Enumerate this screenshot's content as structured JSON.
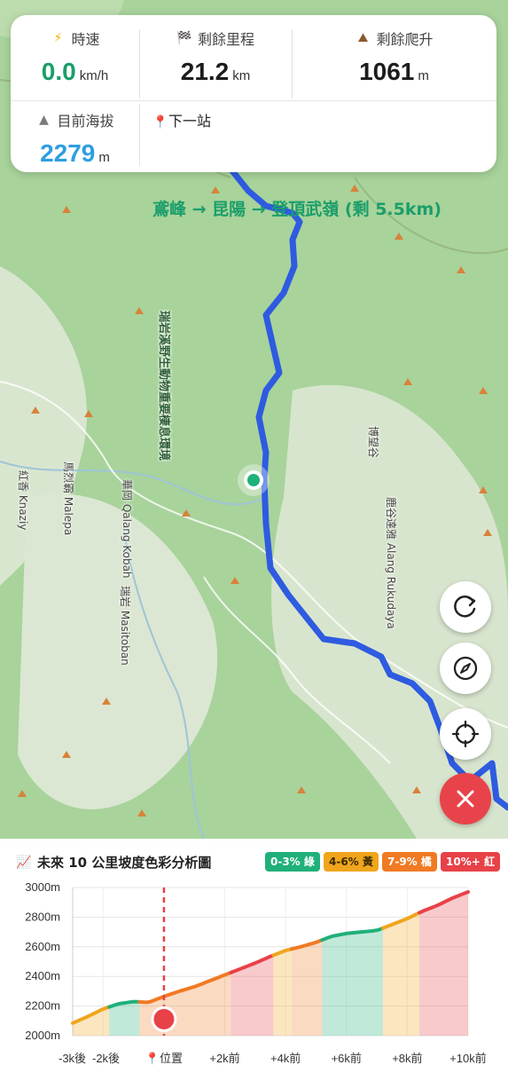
{
  "stats": {
    "speed": {
      "label": "時速",
      "value": "0.0",
      "unit": "km/h"
    },
    "remaining_distance": {
      "label": "剩餘里程",
      "value": "21.2",
      "unit": "km"
    },
    "remaining_climb": {
      "label": "剩餘爬升",
      "value": "1061",
      "unit": "m"
    },
    "altitude": {
      "label": "目前海拔",
      "value": "2279",
      "unit": "m"
    },
    "next_stop": {
      "label": "下一站",
      "value": "鳶峰 → 昆陽 → 登頂武嶺 (剩 5.5km)"
    }
  },
  "map": {
    "labels": {
      "reserve": "瑞岩溪野生動物重要棲息環境",
      "malepa": "馬烈霸 Malepa",
      "knazi": "紅香 Knaziy",
      "qalang_kobah": "華岡 Qalang Kobah",
      "masitoban": "瑞岩 Masitoban",
      "rukudaya": "鹿谷達雅 Alang Rukudaya",
      "road": "博望谷"
    }
  },
  "buttons": {
    "refresh": "refresh-icon",
    "compass": "compass-icon",
    "locate": "crosshair-icon",
    "close": "close-icon"
  },
  "chart_panel": {
    "title": "未來 10 公里坡度色彩分析圖",
    "legend": {
      "green": "0-3% 綠",
      "yellow": "4-6% 黃",
      "orange": "7-9% 橘",
      "red": "10%+ 紅"
    }
  },
  "chart_data": {
    "type": "area",
    "title": "未來 10 公里坡度色彩分析圖",
    "x_ticks": [
      "-3k後",
      "-2k後",
      "位置",
      "+2k前",
      "+4k前",
      "+6k前",
      "+8k前",
      "+10k前"
    ],
    "x_tick_km": [
      -3,
      -2,
      0,
      2,
      4,
      6,
      8,
      10
    ],
    "ylim": [
      2000,
      3000
    ],
    "y_ticks": [
      2000,
      2200,
      2400,
      2600,
      2800,
      3000
    ],
    "y_tick_labels": [
      "2000m",
      "2200m",
      "2400m",
      "2600m",
      "2800m",
      "3000m"
    ],
    "current_position_km": 0,
    "current_altitude": 2279,
    "series": [
      {
        "values_km": [
          -3,
          -2.5,
          -2,
          -1.5,
          -1,
          -0.5,
          0,
          0.5,
          1,
          1.5,
          2,
          2.5,
          3,
          3.5,
          4,
          4.5,
          5,
          5.5,
          6,
          6.5,
          7,
          7.5,
          8,
          8.5,
          9,
          9.5,
          10
        ],
        "altitude": [
          2085,
          2130,
          2180,
          2215,
          2230,
          2225,
          2265,
          2300,
          2330,
          2370,
          2410,
          2450,
          2490,
          2535,
          2575,
          2600,
          2630,
          2670,
          2690,
          2700,
          2710,
          2750,
          2790,
          2840,
          2880,
          2930,
          2970
        ]
      }
    ],
    "grade_segments": [
      {
        "from_km": -3,
        "to_km": -1.8,
        "grade": "yellow"
      },
      {
        "from_km": -1.8,
        "to_km": -0.8,
        "grade": "green"
      },
      {
        "from_km": -0.8,
        "to_km": 0.6,
        "grade": "orange"
      },
      {
        "from_km": 0.6,
        "to_km": 2.2,
        "grade": "orange"
      },
      {
        "from_km": 2.2,
        "to_km": 3.6,
        "grade": "red"
      },
      {
        "from_km": 3.6,
        "to_km": 4.2,
        "grade": "yellow"
      },
      {
        "from_km": 4.2,
        "to_km": 5.2,
        "grade": "orange"
      },
      {
        "from_km": 5.2,
        "to_km": 7.2,
        "grade": "green"
      },
      {
        "from_km": 7.2,
        "to_km": 8.4,
        "grade": "yellow"
      },
      {
        "from_km": 8.4,
        "to_km": 10,
        "grade": "red"
      }
    ],
    "colors": {
      "green": "#20b07a",
      "yellow": "#f0a51c",
      "orange": "#f07a23",
      "red": "#e84148",
      "position_marker": "#e84148"
    }
  }
}
